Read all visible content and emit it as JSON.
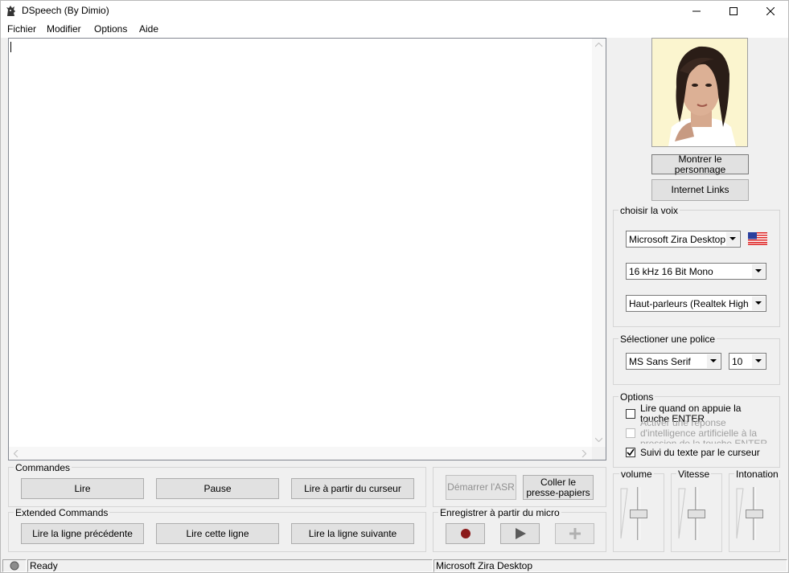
{
  "window": {
    "title": "DSpeech (By Dimio)"
  },
  "menu": {
    "items": [
      "Fichier",
      "Modifier",
      "Options",
      "Aide"
    ]
  },
  "editor": {
    "text": ""
  },
  "character": {
    "show_button": "Montrer le personnage",
    "links_button": "Internet Links"
  },
  "voice": {
    "group_label": "choisir la voix",
    "voice_value": "Microsoft Zira Desktop",
    "format_value": "16 kHz 16 Bit Mono",
    "output_value": "Haut-parleurs (Realtek High Defi",
    "flag_icon": "us-flag-icon"
  },
  "font": {
    "group_label": "Sélectioner une police",
    "font_value": "MS Sans Serif",
    "size_value": "10"
  },
  "options": {
    "group_label": "Options",
    "items": [
      {
        "label": "Lire quand on appuie la touche ENTER",
        "checked": false,
        "enabled": true
      },
      {
        "label": "Activer une réponse d'intelligence artificielle à la pression de la touche ENTER",
        "checked": false,
        "enabled": false
      },
      {
        "label": "Suivi du texte par le curseur",
        "checked": true,
        "enabled": true
      }
    ]
  },
  "sliders": {
    "volume_label": "volume",
    "speed_label": "Vitesse",
    "pitch_label": "Intonation",
    "volume_level": 0.5,
    "speed_level": 0.5,
    "pitch_level": 0.5
  },
  "commands": {
    "group_label": "Commandes",
    "read": "Lire",
    "pause": "Pause",
    "read_from_cursor": "Lire à partir du curseur"
  },
  "extended": {
    "group_label": "Extended Commands",
    "prev_line": "Lire la ligne précédente",
    "this_line": "Lire cette ligne",
    "next_line": "Lire la ligne suivante"
  },
  "asr": {
    "start": "Démarrer l'ASR",
    "paste_line1": "Coller le",
    "paste_line2": "presse-papiers"
  },
  "record": {
    "group_label": "Enregistrer à partir du micro"
  },
  "status": {
    "text": "Ready",
    "voice": "Microsoft Zira Desktop"
  },
  "colors": {
    "record_dot": "#8b1a1a",
    "background": "#f0f0f0"
  }
}
